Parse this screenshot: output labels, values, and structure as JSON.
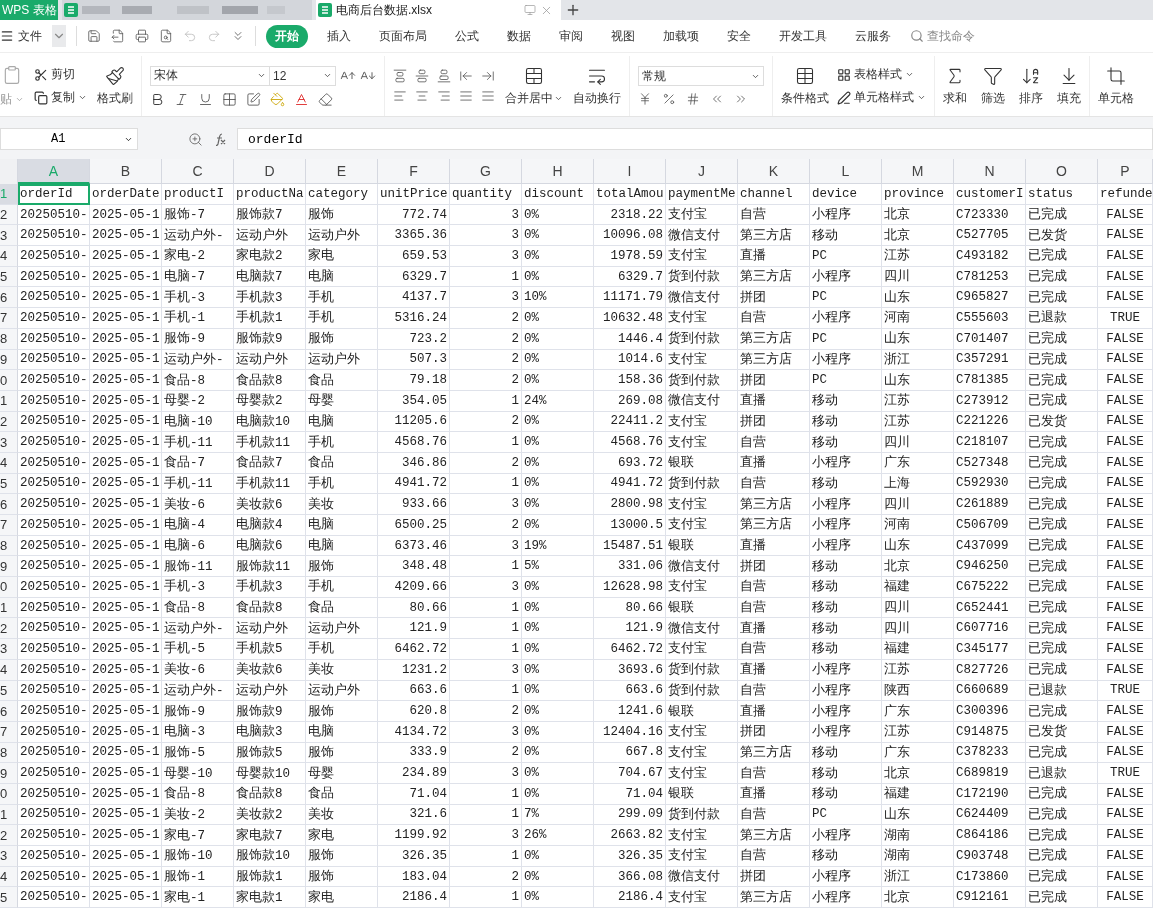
{
  "app_tabs": [
    {
      "kind": "app",
      "label": "WPS 表格",
      "selected": false
    },
    {
      "kind": "blurred",
      "selected": false
    },
    {
      "kind": "file",
      "label": "电商后台数据.xlsx",
      "selected": true
    }
  ],
  "menu": {
    "file_label": "文件",
    "ribbon_tabs": [
      {
        "label": "开始",
        "selected": true
      },
      {
        "label": "插入",
        "selected": false
      },
      {
        "label": "页面布局",
        "selected": false
      },
      {
        "label": "公式",
        "selected": false
      },
      {
        "label": "数据",
        "selected": false
      },
      {
        "label": "审阅",
        "selected": false
      },
      {
        "label": "视图",
        "selected": false
      },
      {
        "label": "加载项",
        "selected": false
      },
      {
        "label": "安全",
        "selected": false
      },
      {
        "label": "开发工具",
        "selected": false
      },
      {
        "label": "云服务",
        "selected": false
      }
    ],
    "search_placeholder": "查找命令"
  },
  "ribbon": {
    "paste_label": "贴",
    "cut_label": "剪切",
    "copy_label": "复制",
    "format_painter_label": "格式刷",
    "font_name": "宋体",
    "font_size": "12",
    "merge_label": "合并居中",
    "wrap_label": "自动换行",
    "number_format": "常规",
    "conditional_label": "条件格式",
    "table_style_label": "表格样式",
    "cell_style_label": "单元格样式",
    "sum_label": "求和",
    "filter_label": "筛选",
    "sort_label": "排序",
    "fill_label": "填充",
    "cell_label": "单元格"
  },
  "formula_bar": {
    "cell_ref": "A1",
    "formula": "orderId"
  },
  "sheet": {
    "columns": [
      {
        "label": "A",
        "selected": true,
        "kind": "text"
      },
      {
        "label": "B",
        "selected": false,
        "kind": "text"
      },
      {
        "label": "C",
        "selected": false,
        "kind": "text"
      },
      {
        "label": "D",
        "selected": false,
        "kind": "text"
      },
      {
        "label": "E",
        "selected": false,
        "kind": "text"
      },
      {
        "label": "F",
        "selected": false,
        "kind": "number"
      },
      {
        "label": "G",
        "selected": false,
        "kind": "number"
      },
      {
        "label": "H",
        "selected": false,
        "kind": "text"
      },
      {
        "label": "I",
        "selected": false,
        "kind": "number"
      },
      {
        "label": "J",
        "selected": false,
        "kind": "text"
      },
      {
        "label": "K",
        "selected": false,
        "kind": "text"
      },
      {
        "label": "L",
        "selected": false,
        "kind": "text"
      },
      {
        "label": "M",
        "selected": false,
        "kind": "text"
      },
      {
        "label": "N",
        "selected": false,
        "kind": "text"
      },
      {
        "label": "O",
        "selected": false,
        "kind": "text"
      },
      {
        "label": "P",
        "selected": false,
        "kind": "boolean"
      }
    ],
    "rows": [
      {
        "num": "1",
        "selected": true,
        "kind": "header",
        "cells": [
          "orderId",
          "orderDate",
          "productI",
          "productNa",
          "category",
          "unitPrice",
          "quantity",
          "discount",
          "totalAmou",
          "paymentMe",
          "channel",
          "device",
          "province",
          "customerI",
          "status",
          "refunde"
        ]
      },
      {
        "num": "2",
        "selected": false,
        "kind": "data",
        "cells": [
          "20250510-",
          "2025-05-1",
          "服饰-7",
          "服饰款7",
          "服饰",
          "772.74",
          "3",
          "0%",
          "2318.22",
          "支付宝",
          "自营",
          "小程序",
          "北京",
          "C723330",
          "已完成",
          "FALSE"
        ]
      },
      {
        "num": "3",
        "selected": false,
        "kind": "data",
        "cells": [
          "20250510-",
          "2025-05-1",
          "运动户外-",
          "运动户外",
          "运动户外",
          "3365.36",
          "3",
          "0%",
          "10096.08",
          "微信支付",
          "第三方店",
          "移动",
          "北京",
          "C527705",
          "已发货",
          "FALSE"
        ]
      },
      {
        "num": "4",
        "selected": false,
        "kind": "data",
        "cells": [
          "20250510-",
          "2025-05-1",
          "家电-2",
          "家电款2",
          "家电",
          "659.53",
          "3",
          "0%",
          "1978.59",
          "支付宝",
          "直播",
          "PC",
          "江苏",
          "C493182",
          "已完成",
          "FALSE"
        ]
      },
      {
        "num": "5",
        "selected": false,
        "kind": "data",
        "cells": [
          "20250510-",
          "2025-05-1",
          "电脑-7",
          "电脑款7",
          "电脑",
          "6329.7",
          "1",
          "0%",
          "6329.7",
          "货到付款",
          "第三方店",
          "小程序",
          "四川",
          "C781253",
          "已完成",
          "FALSE"
        ]
      },
      {
        "num": "6",
        "selected": false,
        "kind": "data",
        "cells": [
          "20250510-",
          "2025-05-1",
          "手机-3",
          "手机款3",
          "手机",
          "4137.7",
          "3",
          "10%",
          "11171.79",
          "微信支付",
          "拼团",
          "PC",
          "山东",
          "C965827",
          "已完成",
          "FALSE"
        ]
      },
      {
        "num": "7",
        "selected": false,
        "kind": "data",
        "cells": [
          "20250510-",
          "2025-05-1",
          "手机-1",
          "手机款1",
          "手机",
          "5316.24",
          "2",
          "0%",
          "10632.48",
          "支付宝",
          "自营",
          "小程序",
          "河南",
          "C555603",
          "已退款",
          "TRUE"
        ]
      },
      {
        "num": "8",
        "selected": false,
        "kind": "data",
        "cells": [
          "20250510-",
          "2025-05-1",
          "服饰-9",
          "服饰款9",
          "服饰",
          "723.2",
          "2",
          "0%",
          "1446.4",
          "货到付款",
          "第三方店",
          "PC",
          "山东",
          "C701407",
          "已完成",
          "FALSE"
        ]
      },
      {
        "num": "9",
        "selected": false,
        "kind": "data",
        "cells": [
          "20250510-",
          "2025-05-1",
          "运动户外-",
          "运动户外",
          "运动户外",
          "507.3",
          "2",
          "0%",
          "1014.6",
          "支付宝",
          "第三方店",
          "小程序",
          "浙江",
          "C357291",
          "已完成",
          "FALSE"
        ]
      },
      {
        "num": "0",
        "selected": false,
        "kind": "data",
        "cells": [
          "20250510-",
          "2025-05-1",
          "食品-8",
          "食品款8",
          "食品",
          "79.18",
          "2",
          "0%",
          "158.36",
          "货到付款",
          "拼团",
          "PC",
          "山东",
          "C781385",
          "已完成",
          "FALSE"
        ]
      },
      {
        "num": "1",
        "selected": false,
        "kind": "data",
        "cells": [
          "20250510-",
          "2025-05-1",
          "母婴-2",
          "母婴款2",
          "母婴",
          "354.05",
          "1",
          "24%",
          "269.08",
          "微信支付",
          "直播",
          "移动",
          "江苏",
          "C273912",
          "已完成",
          "FALSE"
        ]
      },
      {
        "num": "2",
        "selected": false,
        "kind": "data",
        "cells": [
          "20250510-",
          "2025-05-1",
          "电脑-10",
          "电脑款10",
          "电脑",
          "11205.6",
          "2",
          "0%",
          "22411.2",
          "支付宝",
          "拼团",
          "移动",
          "江苏",
          "C221226",
          "已发货",
          "FALSE"
        ]
      },
      {
        "num": "3",
        "selected": false,
        "kind": "data",
        "cells": [
          "20250510-",
          "2025-05-1",
          "手机-11",
          "手机款11",
          "手机",
          "4568.76",
          "1",
          "0%",
          "4568.76",
          "支付宝",
          "自营",
          "移动",
          "四川",
          "C218107",
          "已完成",
          "FALSE"
        ]
      },
      {
        "num": "4",
        "selected": false,
        "kind": "data",
        "cells": [
          "20250510-",
          "2025-05-1",
          "食品-7",
          "食品款7",
          "食品",
          "346.86",
          "2",
          "0%",
          "693.72",
          "银联",
          "直播",
          "小程序",
          "广东",
          "C527348",
          "已完成",
          "FALSE"
        ]
      },
      {
        "num": "5",
        "selected": false,
        "kind": "data",
        "cells": [
          "20250510-",
          "2025-05-1",
          "手机-11",
          "手机款11",
          "手机",
          "4941.72",
          "1",
          "0%",
          "4941.72",
          "货到付款",
          "自营",
          "移动",
          "上海",
          "C592930",
          "已完成",
          "FALSE"
        ]
      },
      {
        "num": "6",
        "selected": false,
        "kind": "data",
        "cells": [
          "20250510-",
          "2025-05-1",
          "美妆-6",
          "美妆款6",
          "美妆",
          "933.66",
          "3",
          "0%",
          "2800.98",
          "支付宝",
          "第三方店",
          "小程序",
          "四川",
          "C261889",
          "已完成",
          "FALSE"
        ]
      },
      {
        "num": "7",
        "selected": false,
        "kind": "data",
        "cells": [
          "20250510-",
          "2025-05-1",
          "电脑-4",
          "电脑款4",
          "电脑",
          "6500.25",
          "2",
          "0%",
          "13000.5",
          "支付宝",
          "第三方店",
          "小程序",
          "河南",
          "C506709",
          "已完成",
          "FALSE"
        ]
      },
      {
        "num": "8",
        "selected": false,
        "kind": "data",
        "cells": [
          "20250510-",
          "2025-05-1",
          "电脑-6",
          "电脑款6",
          "电脑",
          "6373.46",
          "3",
          "19%",
          "15487.51",
          "银联",
          "直播",
          "小程序",
          "山东",
          "C437099",
          "已完成",
          "FALSE"
        ]
      },
      {
        "num": "9",
        "selected": false,
        "kind": "data",
        "cells": [
          "20250510-",
          "2025-05-1",
          "服饰-11",
          "服饰款11",
          "服饰",
          "348.48",
          "1",
          "5%",
          "331.06",
          "微信支付",
          "拼团",
          "移动",
          "北京",
          "C946250",
          "已完成",
          "FALSE"
        ]
      },
      {
        "num": "0",
        "selected": false,
        "kind": "data",
        "cells": [
          "20250510-",
          "2025-05-1",
          "手机-3",
          "手机款3",
          "手机",
          "4209.66",
          "3",
          "0%",
          "12628.98",
          "支付宝",
          "自营",
          "移动",
          "福建",
          "C675222",
          "已完成",
          "FALSE"
        ]
      },
      {
        "num": "1",
        "selected": false,
        "kind": "data",
        "cells": [
          "20250510-",
          "2025-05-1",
          "食品-8",
          "食品款8",
          "食品",
          "80.66",
          "1",
          "0%",
          "80.66",
          "银联",
          "自营",
          "移动",
          "四川",
          "C652441",
          "已完成",
          "FALSE"
        ]
      },
      {
        "num": "2",
        "selected": false,
        "kind": "data",
        "cells": [
          "20250510-",
          "2025-05-1",
          "运动户外-",
          "运动户外",
          "运动户外",
          "121.9",
          "1",
          "0%",
          "121.9",
          "微信支付",
          "直播",
          "移动",
          "四川",
          "C607716",
          "已完成",
          "FALSE"
        ]
      },
      {
        "num": "3",
        "selected": false,
        "kind": "data",
        "cells": [
          "20250510-",
          "2025-05-1",
          "手机-5",
          "手机款5",
          "手机",
          "6462.72",
          "1",
          "0%",
          "6462.72",
          "支付宝",
          "自营",
          "移动",
          "福建",
          "C345177",
          "已完成",
          "FALSE"
        ]
      },
      {
        "num": "4",
        "selected": false,
        "kind": "data",
        "cells": [
          "20250510-",
          "2025-05-1",
          "美妆-6",
          "美妆款6",
          "美妆",
          "1231.2",
          "3",
          "0%",
          "3693.6",
          "货到付款",
          "直播",
          "小程序",
          "江苏",
          "C827726",
          "已完成",
          "FALSE"
        ]
      },
      {
        "num": "5",
        "selected": false,
        "kind": "data",
        "cells": [
          "20250510-",
          "2025-05-1",
          "运动户外-",
          "运动户外",
          "运动户外",
          "663.6",
          "1",
          "0%",
          "663.6",
          "货到付款",
          "自营",
          "小程序",
          "陕西",
          "C660689",
          "已退款",
          "TRUE"
        ]
      },
      {
        "num": "6",
        "selected": false,
        "kind": "data",
        "cells": [
          "20250510-",
          "2025-05-1",
          "服饰-9",
          "服饰款9",
          "服饰",
          "620.8",
          "2",
          "0%",
          "1241.6",
          "银联",
          "直播",
          "小程序",
          "广东",
          "C300396",
          "已完成",
          "FALSE"
        ]
      },
      {
        "num": "7",
        "selected": false,
        "kind": "data",
        "cells": [
          "20250510-",
          "2025-05-1",
          "电脑-3",
          "电脑款3",
          "电脑",
          "4134.72",
          "3",
          "0%",
          "12404.16",
          "支付宝",
          "拼团",
          "小程序",
          "江苏",
          "C914875",
          "已发货",
          "FALSE"
        ]
      },
      {
        "num": "8",
        "selected": false,
        "kind": "data",
        "cells": [
          "20250510-",
          "2025-05-1",
          "服饰-5",
          "服饰款5",
          "服饰",
          "333.9",
          "2",
          "0%",
          "667.8",
          "支付宝",
          "第三方店",
          "移动",
          "广东",
          "C378233",
          "已完成",
          "FALSE"
        ]
      },
      {
        "num": "9",
        "selected": false,
        "kind": "data",
        "cells": [
          "20250510-",
          "2025-05-1",
          "母婴-10",
          "母婴款10",
          "母婴",
          "234.89",
          "3",
          "0%",
          "704.67",
          "支付宝",
          "自营",
          "移动",
          "北京",
          "C689819",
          "已退款",
          "TRUE"
        ]
      },
      {
        "num": "0",
        "selected": false,
        "kind": "data",
        "cells": [
          "20250510-",
          "2025-05-1",
          "食品-8",
          "食品款8",
          "食品",
          "71.04",
          "1",
          "0%",
          "71.04",
          "银联",
          "直播",
          "移动",
          "福建",
          "C172190",
          "已完成",
          "FALSE"
        ]
      },
      {
        "num": "1",
        "selected": false,
        "kind": "data",
        "cells": [
          "20250510-",
          "2025-05-1",
          "美妆-2",
          "美妆款2",
          "美妆",
          "321.6",
          "1",
          "7%",
          "299.09",
          "货到付款",
          "自营",
          "PC",
          "山东",
          "C624409",
          "已完成",
          "FALSE"
        ]
      },
      {
        "num": "2",
        "selected": false,
        "kind": "data",
        "cells": [
          "20250510-",
          "2025-05-1",
          "家电-7",
          "家电款7",
          "家电",
          "1199.92",
          "3",
          "26%",
          "2663.82",
          "支付宝",
          "第三方店",
          "小程序",
          "湖南",
          "C864186",
          "已完成",
          "FALSE"
        ]
      },
      {
        "num": "3",
        "selected": false,
        "kind": "data",
        "cells": [
          "20250510-",
          "2025-05-1",
          "服饰-10",
          "服饰款10",
          "服饰",
          "326.35",
          "1",
          "0%",
          "326.35",
          "支付宝",
          "自营",
          "移动",
          "湖南",
          "C903748",
          "已完成",
          "FALSE"
        ]
      },
      {
        "num": "4",
        "selected": false,
        "kind": "data",
        "cells": [
          "20250510-",
          "2025-05-1",
          "服饰-1",
          "服饰款1",
          "服饰",
          "183.04",
          "2",
          "0%",
          "366.08",
          "微信支付",
          "拼团",
          "小程序",
          "浙江",
          "C173860",
          "已完成",
          "FALSE"
        ]
      },
      {
        "num": "5",
        "selected": false,
        "kind": "data",
        "cells": [
          "20250510-",
          "2025-05-1",
          "家电-1",
          "家电款1",
          "家电",
          "2186.4",
          "1",
          "0%",
          "2186.4",
          "支付宝",
          "第三方店",
          "小程序",
          "北京",
          "C912161",
          "已完成",
          "FALSE"
        ]
      }
    ]
  }
}
